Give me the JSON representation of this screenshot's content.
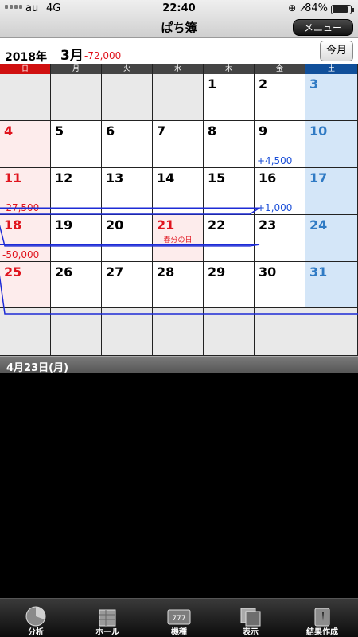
{
  "status_bar": {
    "carrier": "au",
    "network": "4G",
    "time": "22:40",
    "battery": "84%",
    "icons": [
      "orientation-lock-icon",
      "location-icon"
    ]
  },
  "nav": {
    "title": "ぱち簿",
    "menu_label": "メニュー"
  },
  "header": {
    "year": "2018年",
    "month": "3月",
    "month_total": "-72,000",
    "this_month_label": "今月"
  },
  "weekdays": [
    "日",
    "月",
    "火",
    "水",
    "木",
    "金",
    "土"
  ],
  "colors": {
    "sunday": "#d01010",
    "saturday": "#104f9a",
    "positive": "#1b4fd8",
    "negative": "#e0141e",
    "trend_line": "#1d2bd6"
  },
  "weeks": [
    [
      {
        "day": "",
        "type": "other"
      },
      {
        "day": "",
        "type": "other"
      },
      {
        "day": "",
        "type": "other"
      },
      {
        "day": "",
        "type": "other"
      },
      {
        "day": "1",
        "type": "normal"
      },
      {
        "day": "2",
        "type": "normal"
      },
      {
        "day": "3",
        "type": "sat"
      }
    ],
    [
      {
        "day": "4",
        "type": "sun"
      },
      {
        "day": "5",
        "type": "normal"
      },
      {
        "day": "6",
        "type": "normal"
      },
      {
        "day": "7",
        "type": "normal"
      },
      {
        "day": "8",
        "type": "normal"
      },
      {
        "day": "9",
        "type": "normal",
        "amount": "+4,500",
        "sign": "pos"
      },
      {
        "day": "10",
        "type": "sat"
      }
    ],
    [
      {
        "day": "11",
        "type": "sun",
        "amount": "-27,500",
        "sign": "neg"
      },
      {
        "day": "12",
        "type": "normal"
      },
      {
        "day": "13",
        "type": "normal"
      },
      {
        "day": "14",
        "type": "normal"
      },
      {
        "day": "15",
        "type": "normal"
      },
      {
        "day": "16",
        "type": "normal",
        "amount": "+1,000",
        "sign": "pos"
      },
      {
        "day": "17",
        "type": "sat"
      }
    ],
    [
      {
        "day": "18",
        "type": "sun",
        "amount": "-50,000",
        "sign": "neg"
      },
      {
        "day": "19",
        "type": "normal"
      },
      {
        "day": "20",
        "type": "normal"
      },
      {
        "day": "21",
        "type": "holiday",
        "holiday": "春分の日"
      },
      {
        "day": "22",
        "type": "normal"
      },
      {
        "day": "23",
        "type": "normal"
      },
      {
        "day": "24",
        "type": "sat"
      }
    ],
    [
      {
        "day": "25",
        "type": "sun"
      },
      {
        "day": "26",
        "type": "normal"
      },
      {
        "day": "27",
        "type": "normal"
      },
      {
        "day": "28",
        "type": "normal"
      },
      {
        "day": "29",
        "type": "normal"
      },
      {
        "day": "30",
        "type": "normal"
      },
      {
        "day": "31",
        "type": "sat"
      }
    ],
    [
      {
        "day": "",
        "type": "other"
      },
      {
        "day": "",
        "type": "other"
      },
      {
        "day": "",
        "type": "other"
      },
      {
        "day": "",
        "type": "other"
      },
      {
        "day": "",
        "type": "other"
      },
      {
        "day": "",
        "type": "other"
      },
      {
        "day": "",
        "type": "other"
      }
    ]
  ],
  "cumulative_balance": [
    {
      "day": 1,
      "balance": 0
    },
    {
      "day": 9,
      "balance": 4500
    },
    {
      "day": 11,
      "balance": -23000
    },
    {
      "day": 16,
      "balance": -22000
    },
    {
      "day": 18,
      "balance": -72000
    },
    {
      "day": 31,
      "balance": -72000
    }
  ],
  "selected_date": "4月23日(月)",
  "tabs": [
    {
      "label": "分析",
      "icon": "pie-chart-icon"
    },
    {
      "label": "ホール",
      "icon": "building-icon"
    },
    {
      "label": "機種",
      "icon": "slot-machine-icon"
    },
    {
      "label": "表示",
      "icon": "display-icon"
    },
    {
      "label": "結果作成",
      "icon": "pencil-icon"
    }
  ]
}
